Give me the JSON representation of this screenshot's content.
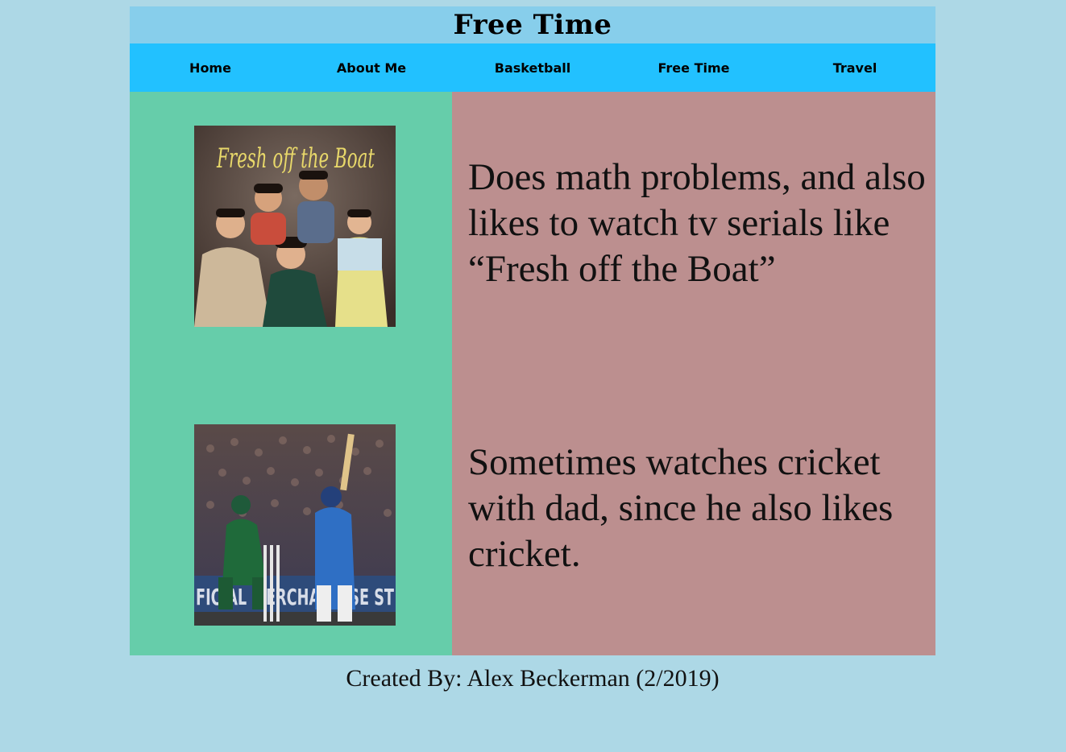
{
  "page_title": "Free Time",
  "nav": [
    {
      "label": "Home"
    },
    {
      "label": "About Me"
    },
    {
      "label": "Basketball"
    },
    {
      "label": "Free Time"
    },
    {
      "label": "Travel"
    }
  ],
  "images": [
    {
      "caption_text": "Fresh off the Boat"
    },
    {
      "caption_text": "FICIAL MERCHANDISE ST"
    }
  ],
  "paragraphs": [
    "Does math problems, and also likes to watch tv serials like “Fresh off the Boat”",
    "Sometimes watches cricket with dad, since he also likes cricket."
  ],
  "footer": "Created By: Alex Beckerman (2/2019)",
  "colors": {
    "page_bg": "#add8e6",
    "header_bg": "#87ceeb",
    "nav_bg": "#22c1ff",
    "left_column_bg": "#66cdaa",
    "right_column_bg": "#bc8f8f"
  }
}
